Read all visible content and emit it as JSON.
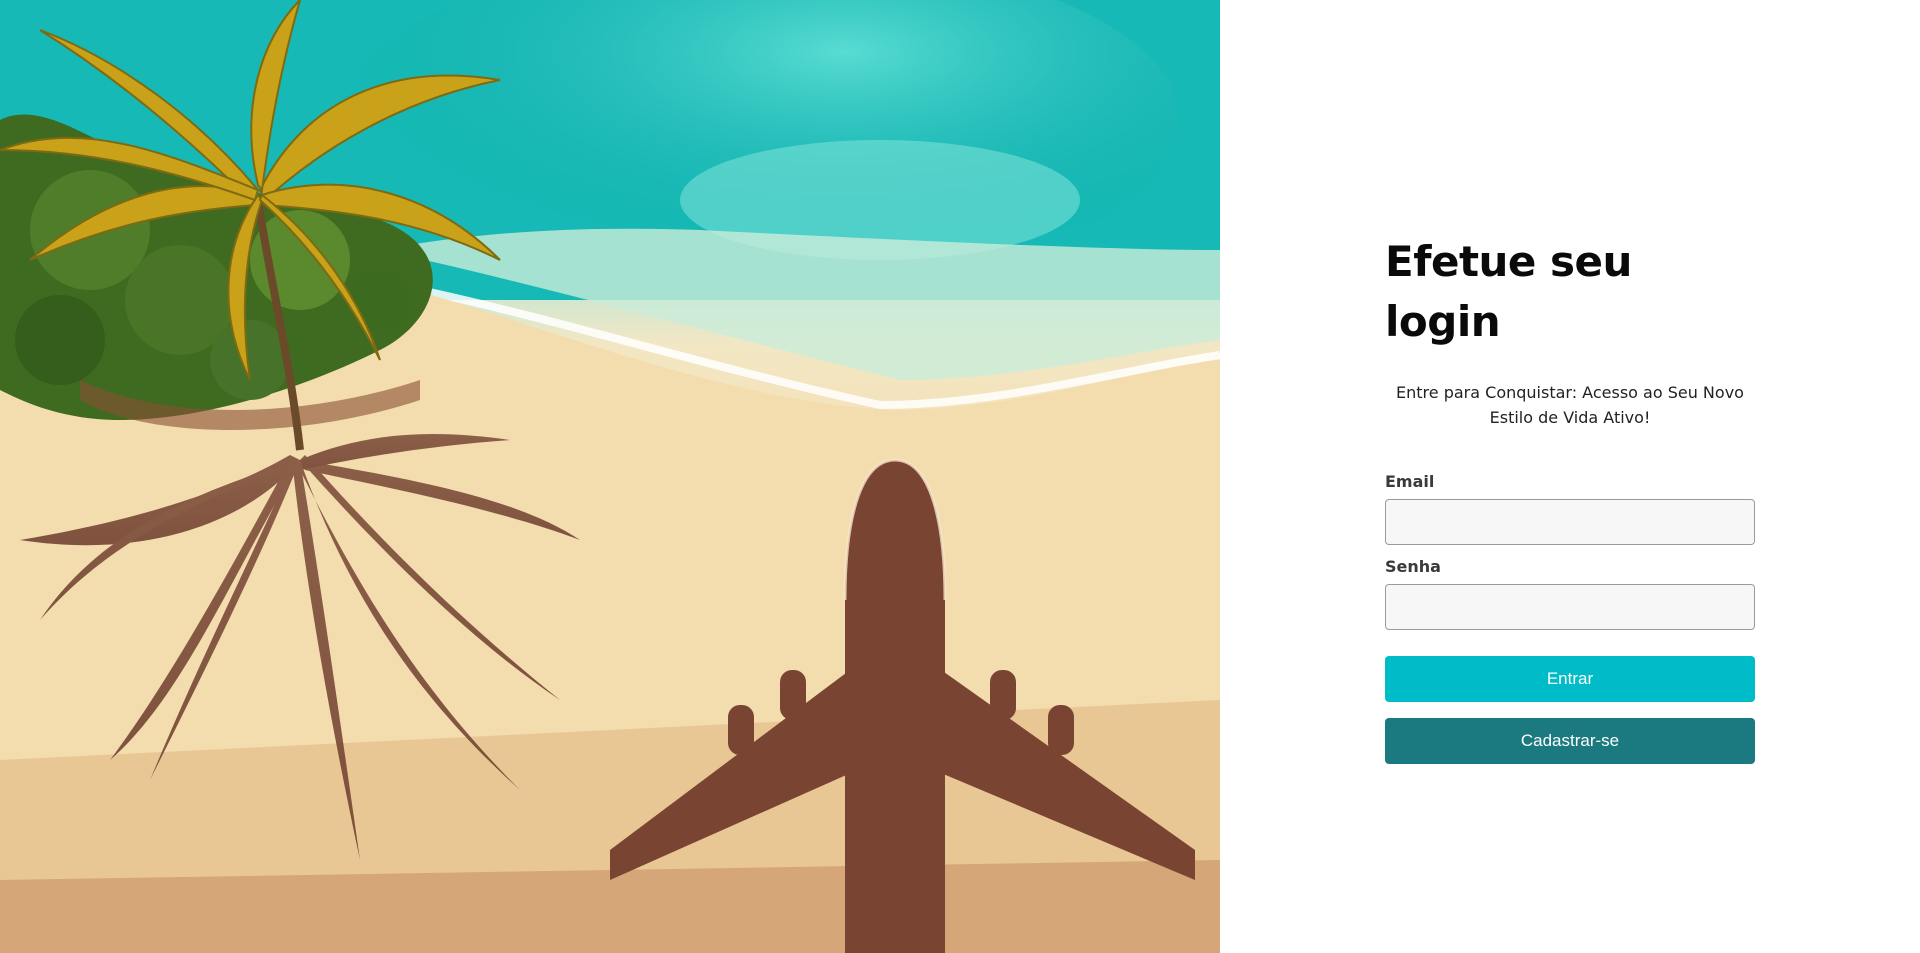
{
  "hero": {
    "image": "tropical-beach-airplane-shadow-illustration",
    "colors": {
      "sea": "#19bdb8",
      "sand": "#f4dcae",
      "shadow": "#7a4432",
      "palm_leaf": "#c7a21a",
      "foliage": "#3d6a22"
    }
  },
  "login": {
    "title": "Efetue seu login",
    "subtitle": "Entre para Conquistar: Acesso ao Seu Novo Estilo de Vida Ativo!",
    "email_label": "Email",
    "email_value": "",
    "password_label": "Senha",
    "password_value": "",
    "submit_label": "Entrar",
    "register_label": "Cadastrar-se"
  },
  "colors": {
    "primary_button": "#00bcc8",
    "secondary_button": "#1b7a80",
    "title_text": "#0a0a0a"
  }
}
